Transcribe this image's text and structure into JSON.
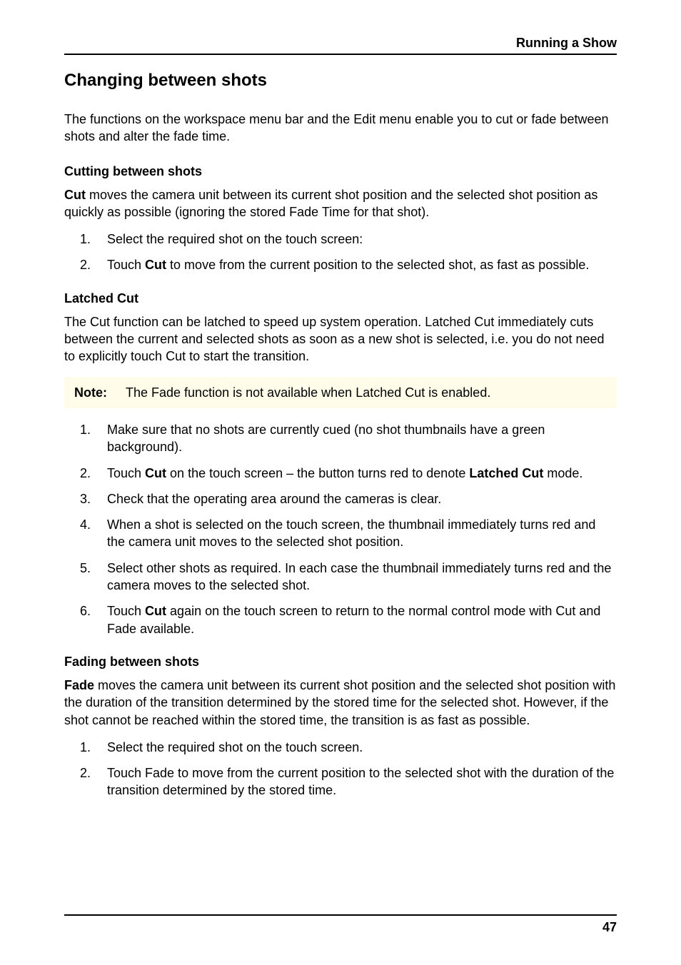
{
  "header": {
    "section_title": "Running a Show"
  },
  "h1": "Changing between shots",
  "intro": "The functions on the workspace menu bar and the Edit menu enable you to cut or fade between shots and alter the fade time.",
  "cutting": {
    "heading": "Cutting between shots",
    "lead_bold": "Cut",
    "lead_rest": " moves the camera unit between its current shot position and the selected shot position as quickly as possible (ignoring the stored Fade Time for that shot).",
    "steps": [
      {
        "num": "1.",
        "plain": "Select the required shot on the touch screen:"
      },
      {
        "num": "2.",
        "pre": "Touch ",
        "bold": "Cut",
        "post": " to move from the current position to the selected shot, as fast as possible."
      }
    ]
  },
  "latched": {
    "heading": "Latched Cut",
    "para": "The Cut function can be latched to speed up system operation. Latched Cut immediately cuts between the current and selected shots as soon as a new shot is selected, i.e. you do not need to explicitly touch Cut to start the transition.",
    "note_label": "Note:",
    "note_text": "The Fade function is not available when Latched Cut is enabled.",
    "steps": [
      {
        "num": "1.",
        "plain": "Make sure that no shots are currently cued (no shot thumbnails have a green background)."
      },
      {
        "num": "2.",
        "pre": "Touch ",
        "bold": "Cut",
        "mid": " on the touch screen – the button turns red to denote ",
        "bold2": "Latched Cut",
        "post": " mode."
      },
      {
        "num": "3.",
        "plain": "Check that the operating area around the cameras is clear."
      },
      {
        "num": "4.",
        "plain": "When a shot is selected on the touch screen, the thumbnail immediately turns red and the camera unit moves to the selected shot position."
      },
      {
        "num": "5.",
        "plain": "Select other shots as required. In each case the thumbnail immediately turns red and the camera moves to the selected shot."
      },
      {
        "num": "6.",
        "pre": "Touch ",
        "bold": "Cut",
        "post": " again on the touch screen to return to the normal control mode with Cut and Fade available."
      }
    ]
  },
  "fading": {
    "heading": "Fading between shots",
    "lead_bold": "Fade",
    "lead_rest": " moves the camera unit between its current shot position and the selected shot position with the duration of the transition determined by the stored time for the selected shot. However, if the shot cannot be reached within the stored time, the transition is as fast as possible.",
    "steps": [
      {
        "num": "1.",
        "plain": "Select the required shot on the touch screen."
      },
      {
        "num": "2.",
        "plain": "Touch Fade to move from the current position to the selected shot with the duration of the transition determined by the stored time."
      }
    ]
  },
  "footer": {
    "page_number": "47"
  }
}
